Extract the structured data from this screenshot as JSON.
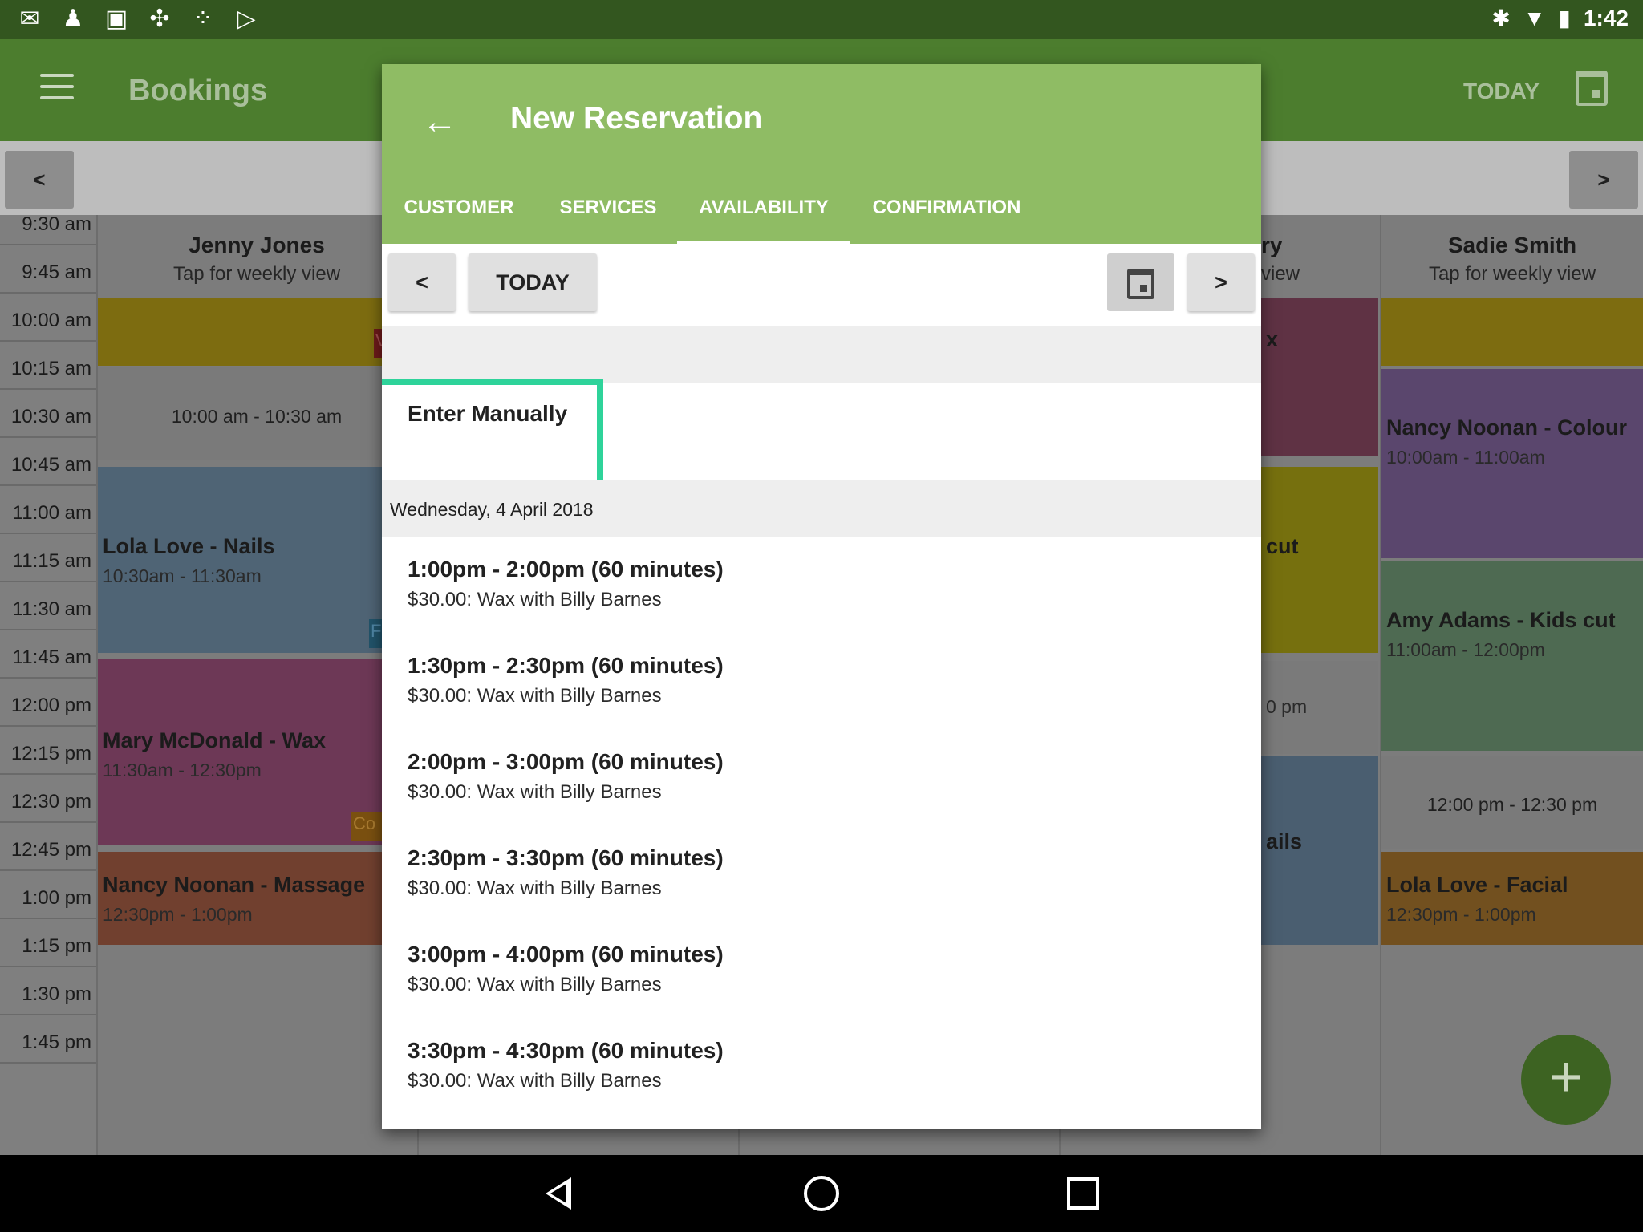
{
  "status_bar": {
    "time": "1:42"
  },
  "app_bar": {
    "title": "Bookings",
    "today_label": "TODAY"
  },
  "nav": {
    "prev": "<",
    "next": ">"
  },
  "schedule": {
    "times": [
      "9:30 am",
      "9:45 am",
      "10:00 am",
      "10:15 am",
      "10:30 am",
      "10:45 am",
      "11:00 am",
      "11:15 am",
      "11:30 am",
      "11:45 am",
      "12:00 pm",
      "12:15 pm",
      "12:30 pm",
      "12:45 pm",
      "1:00 pm",
      "1:15 pm",
      "1:30 pm",
      "1:45 pm"
    ],
    "columns": [
      {
        "name": "Jenny Jones",
        "sub": "Tap for weekly view"
      },
      {
        "name": "Sadie Smith",
        "sub": "Tap for weekly view"
      }
    ],
    "partial_column": {
      "name": "ry",
      "sub": "view"
    },
    "jenny_blocks": {
      "slot_10": "10:00 am - 10:30 am",
      "lola_title": "Lola Love - Nails",
      "lola_time": "10:30am - 11:30am",
      "mary_title": "Mary McDonald - Wax",
      "mary_time": "11:30am - 12:30pm",
      "nancy_title": "Nancy Noonan - Massage",
      "nancy_time": "12:30pm - 1:00pm",
      "tag_v": "V",
      "tag_f": "F",
      "tag_co": "Co"
    },
    "partial_blocks": {
      "x": "x",
      "cut": "cut",
      "pm": "0 pm",
      "ails": "ails"
    },
    "sadie_blocks": {
      "nancy_title": "Nancy Noonan - Colour",
      "nancy_time": "10:00am - 11:00am",
      "amy_title": "Amy Adams - Kids cut",
      "amy_time": "11:00am - 12:00pm",
      "slot_12": "12:00 pm - 12:30 pm",
      "lola_title": "Lola Love - Facial",
      "lola_time": "12:30pm - 1:00pm"
    }
  },
  "fab": {
    "label": "+"
  },
  "dialog": {
    "title": "New Reservation",
    "tabs": [
      "CUSTOMER",
      "SERVICES",
      "AVAILABILITY",
      "CONFIRMATION"
    ],
    "active_tab": "AVAILABILITY",
    "nav": {
      "prev": "<",
      "today": "TODAY",
      "next": ">"
    },
    "enter_manually": "Enter Manually",
    "date_header": "Wednesday, 4 April 2018",
    "slots": [
      {
        "time": "1:00pm - 2:00pm (60 minutes)",
        "detail": "$30.00: Wax with Billy Barnes"
      },
      {
        "time": "1:30pm - 2:30pm (60 minutes)",
        "detail": "$30.00: Wax with Billy Barnes"
      },
      {
        "time": "2:00pm - 3:00pm (60 minutes)",
        "detail": "$30.00: Wax with Billy Barnes"
      },
      {
        "time": "2:30pm - 3:30pm (60 minutes)",
        "detail": "$30.00: Wax with Billy Barnes"
      },
      {
        "time": "3:00pm - 4:00pm (60 minutes)",
        "detail": "$30.00: Wax with Billy Barnes"
      },
      {
        "time": "3:30pm - 4:30pm (60 minutes)",
        "detail": "$30.00: Wax with Billy Barnes"
      }
    ]
  },
  "colors": {
    "primary": "#4c7d2e",
    "dialog_header": "#8fbc64",
    "highlight": "#2ed39a",
    "status_bar": "#33561f"
  }
}
